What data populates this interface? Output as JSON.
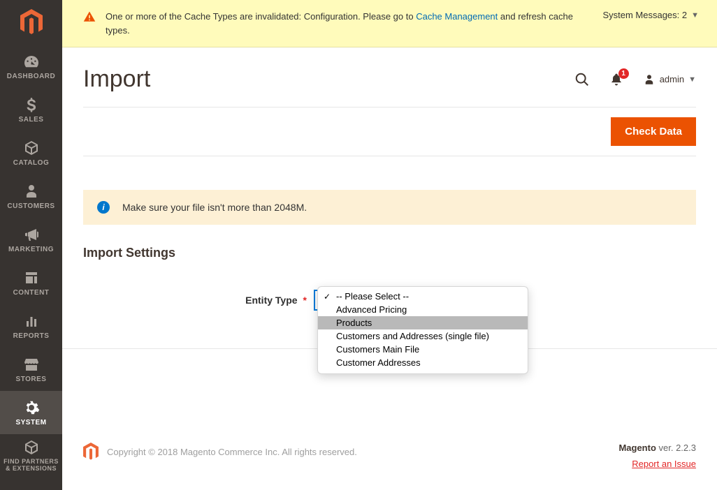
{
  "sidebar": {
    "items": [
      {
        "label": "DASHBOARD"
      },
      {
        "label": "SALES"
      },
      {
        "label": "CATALOG"
      },
      {
        "label": "CUSTOMERS"
      },
      {
        "label": "MARKETING"
      },
      {
        "label": "CONTENT"
      },
      {
        "label": "REPORTS"
      },
      {
        "label": "STORES"
      },
      {
        "label": "SYSTEM"
      },
      {
        "label": "FIND PARTNERS & EXTENSIONS"
      }
    ]
  },
  "system_message": {
    "text_before_link": "One or more of the Cache Types are invalidated: Configuration. Please go to ",
    "link_text": "Cache Management",
    "text_after_link": " and refresh cache types.",
    "counter_label": "System Messages: 2"
  },
  "header": {
    "title": "Import",
    "admin_label": "admin",
    "notification_count": "1"
  },
  "actions": {
    "check_data": "Check Data"
  },
  "notice": {
    "text": "Make sure your file isn't more than 2048M."
  },
  "section": {
    "import_settings": "Import Settings"
  },
  "form": {
    "entity_type": {
      "label": "Entity Type",
      "options": [
        "-- Please Select --",
        "Advanced Pricing",
        "Products",
        "Customers and Addresses (single file)",
        "Customers Main File",
        "Customer Addresses"
      ],
      "selected_index": 0,
      "highlight_index": 2
    }
  },
  "footer": {
    "copyright": "Copyright © 2018 Magento Commerce Inc. All rights reserved.",
    "product": "Magento",
    "version_prefix": " ver. ",
    "version": "2.2.3",
    "report_link": "Report an Issue"
  }
}
